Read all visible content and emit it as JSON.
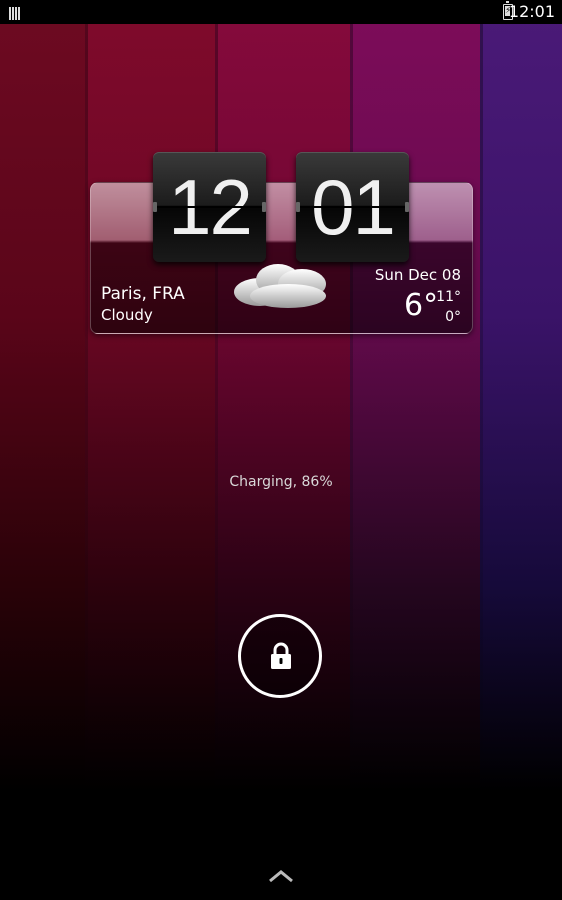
{
  "status_bar": {
    "time": "12:01",
    "icons": [
      "notification-bars-icon",
      "battery-charging-icon"
    ]
  },
  "clock": {
    "hours": "12",
    "minutes": "01"
  },
  "weather": {
    "city": "Paris, FRA",
    "condition": "Cloudy",
    "date": "Sun Dec 08",
    "temp_now": "6°",
    "temp_high": "11°",
    "temp_low": "0°",
    "icon": "cloud-icon"
  },
  "lockscreen": {
    "charging_text": "Charging, 86%",
    "battery_percent": 86,
    "unlock_icon": "lock-icon",
    "expand_icon": "chevron-up-icon"
  },
  "colors": {
    "text": "#ffffff",
    "ring": "#ffffff",
    "wallpaper_stripes": [
      "#6e0a22",
      "#800a2c",
      "#860a3c",
      "#7e0c5a",
      "#4b1a78"
    ]
  }
}
